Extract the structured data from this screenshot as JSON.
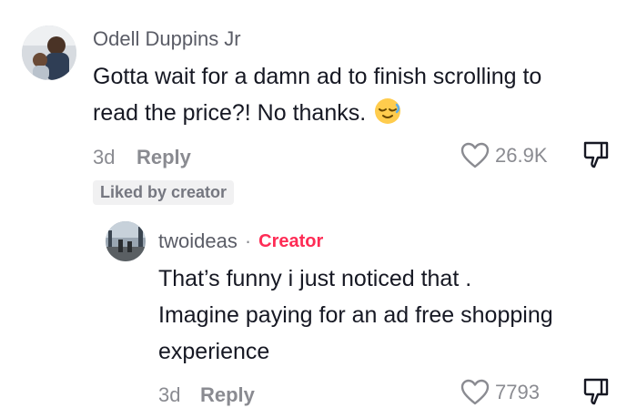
{
  "comment": {
    "author": "Odell Duppins Jr",
    "text_line1": "Gotta wait for a damn ad to finish scrolling to",
    "text_line2": "read the price?! No thanks.",
    "emoji": "relieved-face-emoji",
    "age": "3d",
    "reply_label": "Reply",
    "like_count": "26.9K",
    "liked_by_creator": "Liked by creator"
  },
  "reply": {
    "author": "twoideas",
    "separator": "·",
    "creator_label": "Creator",
    "text_line1": "That’s funny i just noticed that .",
    "text_line2": "Imagine paying for an ad free shopping",
    "text_line3": "experience",
    "age": "3d",
    "reply_label": "Reply",
    "like_count": "7793"
  },
  "icons": {
    "like": "heart-outline-icon",
    "dislike": "thumbs-down-icon"
  },
  "colors": {
    "text": "#161823",
    "muted": "#8a8b91",
    "creator_accent": "#fe2c55",
    "badge_bg": "#f1f1f2"
  }
}
